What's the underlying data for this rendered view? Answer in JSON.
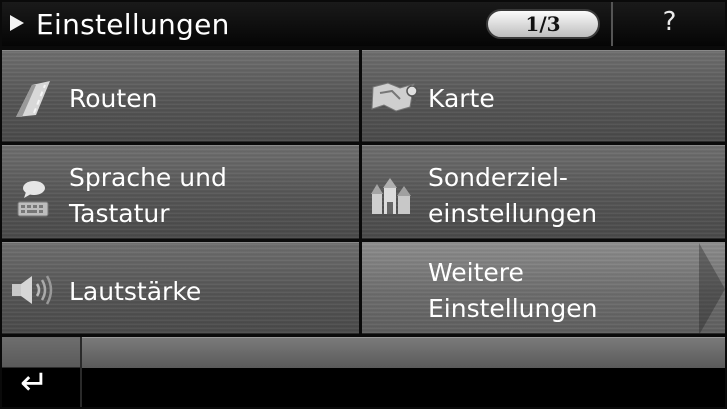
{
  "header": {
    "title": "Einstellungen",
    "page_indicator": "1/3",
    "help_label": "?"
  },
  "menu": {
    "routen": "Routen",
    "karte": "Karte",
    "sprache_line1": "Sprache und",
    "sprache_line2": "Tastatur",
    "sonder_line1": "Sonderziel-",
    "sonder_line2": "einstellungen",
    "lautstaerke": "Lautstärke",
    "weitere_line1": "Weitere",
    "weitere_line2": "Einstellungen"
  },
  "icons": {
    "routen": "road-icon",
    "karte": "map-icon",
    "sprache": "keyboard-speech-icon",
    "sonder": "poi-buildings-icon",
    "lautstaerke": "speaker-icon",
    "back": "return-arrow-icon",
    "title_arrow": "play-arrow-icon"
  },
  "footer": {
    "back_glyph": "↵"
  }
}
